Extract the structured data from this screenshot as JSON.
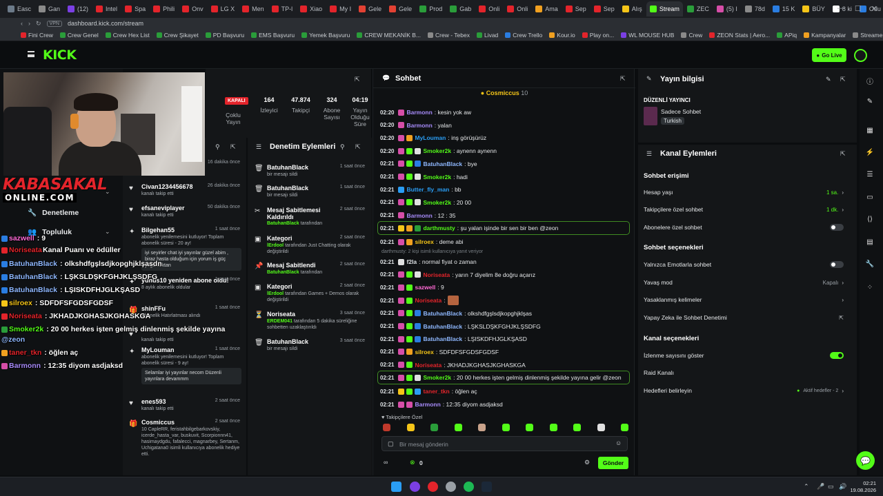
{
  "browser": {
    "tabs": [
      {
        "label": "Easc",
        "color": "#6c7a89"
      },
      {
        "label": "Gan",
        "color": "#8a8a8a"
      },
      {
        "label": "(12)",
        "color": "#7b3fe4"
      },
      {
        "label": "Intel",
        "color": "#e3242b"
      },
      {
        "label": "Spa",
        "color": "#e3242b"
      },
      {
        "label": "Phili",
        "color": "#e3242b"
      },
      {
        "label": "Onv",
        "color": "#e3242b"
      },
      {
        "label": "LG X",
        "color": "#e3242b"
      },
      {
        "label": "Men",
        "color": "#e3242b"
      },
      {
        "label": "TP-l",
        "color": "#e3242b"
      },
      {
        "label": "Xiao",
        "color": "#e3242b"
      },
      {
        "label": "My I",
        "color": "#e3242b"
      },
      {
        "label": "Gele",
        "color": "#e34133"
      },
      {
        "label": "Gele",
        "color": "#e34133"
      },
      {
        "label": "Prod",
        "color": "#2a9d3a"
      },
      {
        "label": "Gab",
        "color": "#2a9d3a"
      },
      {
        "label": "Onli",
        "color": "#e3242b"
      },
      {
        "label": "Onli",
        "color": "#e3242b"
      },
      {
        "label": "Ama",
        "color": "#f0a020"
      },
      {
        "label": "Sep",
        "color": "#e3242b"
      },
      {
        "label": "Sep",
        "color": "#e3242b"
      },
      {
        "label": "Alış",
        "color": "#f5c518"
      },
      {
        "label": "Stream",
        "color": "#53fc18",
        "active": true
      },
      {
        "label": "ZEC",
        "color": "#2a9d3a"
      },
      {
        "label": "(5) I",
        "color": "#d64ea8"
      },
      {
        "label": "78d",
        "color": "#8a8a8a"
      },
      {
        "label": "15 K",
        "color": "#2a7de1"
      },
      {
        "label": "BÜY",
        "color": "#f5c518"
      },
      {
        "label": "8 ki",
        "color": "#ffffff"
      },
      {
        "label": "Odu",
        "color": "#2a7de1"
      },
      {
        "label": "Jak",
        "color": "#e3242b"
      }
    ],
    "url": "dashboard.kick.com/stream",
    "vpn": "VPN",
    "bookmarks": [
      {
        "label": "Fini Crew",
        "color": "#e3242b"
      },
      {
        "label": "Crew Genel",
        "color": "#2a9d3a"
      },
      {
        "label": "Crew Hex List",
        "color": "#2a9d3a"
      },
      {
        "label": "Crew Şikayet",
        "color": "#2a9d3a"
      },
      {
        "label": "PD Başvuru",
        "color": "#2a9d3a"
      },
      {
        "label": "EMS Başvuru",
        "color": "#2a9d3a"
      },
      {
        "label": "Yemek Başvuru",
        "color": "#2a9d3a"
      },
      {
        "label": "CREW MEKANİK B...",
        "color": "#2a9d3a"
      },
      {
        "label": "Crew - Tebex",
        "color": "#8a8a8a"
      },
      {
        "label": "Livad",
        "color": "#2a9d3a"
      },
      {
        "label": "Crew Trello",
        "color": "#2a7de1"
      },
      {
        "label": "Kour.io",
        "color": "#f0a020"
      },
      {
        "label": "Play on...",
        "color": "#e3242b"
      },
      {
        "label": "WL MOUSE HUB",
        "color": "#7b3fe4"
      },
      {
        "label": "Crew",
        "color": "#8a8a8a"
      },
      {
        "label": "ZEON Stats | Aero...",
        "color": "#e3242b"
      },
      {
        "label": "APiq",
        "color": "#2a9d3a"
      },
      {
        "label": "Kampanyalar",
        "color": "#f0a020"
      },
      {
        "label": "Streamer Panel",
        "color": "#8a8a8a"
      }
    ]
  },
  "header": {
    "logo": "KICK",
    "go_live": "Go Live"
  },
  "overlay": {
    "brand_big": "KABASAKAL",
    "brand_small": "ONLINE.COM",
    "chat": [
      {
        "user": "sazwell",
        "text": ": 9",
        "color": "#ff6ad5",
        "badge": "#2a7de1"
      },
      {
        "user": "Noriseata",
        "text": "",
        "color": "#e3242b",
        "badge": "#e3242b"
      },
      {
        "user": "BatuhanBlack",
        "text": ": olkshdfgşlsdjkopghjklşasdn",
        "color": "#8fb8ff",
        "badge": "#2a7de1"
      },
      {
        "user": "BatuhanBlack",
        "text": ": LŞKSLDŞKFGHJKLŞSDFG",
        "color": "#8fb8ff",
        "badge": "#2a7de1"
      },
      {
        "user": "BatuhanBlack",
        "text": ": LŞISKDFHJGLKŞASD",
        "color": "#8fb8ff",
        "badge": "#2a7de1"
      },
      {
        "user": "silroex",
        "text": ": SDFDFSFGDSFGDSF",
        "color": "#f5c518",
        "badge": "#f5c518"
      },
      {
        "user": "Noriseata",
        "text": ": JKHADJKGHASJKGHASKGA",
        "color": "#e3242b",
        "badge": "#e3242b"
      },
      {
        "user": "Smoker2k",
        "text": ": 20 00 herkes işten gelmiş dinlenmiş şekilde yayına",
        "color": "#53fc18",
        "badge": "#2a9d3a"
      },
      {
        "user": "@zeon",
        "text": "",
        "color": "#8fb8ff",
        "badge": ""
      },
      {
        "user": "taner_tkn",
        "text": ": öğlen aç",
        "color": "#e3242b",
        "badge": "#f0a020"
      },
      {
        "user": "Barmonn",
        "text": ": 12:35 diyom asdjaksd",
        "color": "#a78bfa",
        "badge": "#d64ea8"
      }
    ]
  },
  "leftnav": {
    "items": [
      {
        "label": "Denetleme"
      },
      {
        "label": "Topluluk"
      },
      {
        "label": "Kanal Puanı ve ödüller"
      }
    ]
  },
  "stats": {
    "status": "KAPALI",
    "chat_mode_label": "Çoklu Yayın",
    "viewers": {
      "value": "164",
      "label": "İzleyici"
    },
    "followers": {
      "value": "47.874",
      "label": "Takipçi"
    },
    "subs": {
      "value": "324",
      "label": "Abone Sayısı"
    },
    "duration": {
      "value": "04:19",
      "label": "Yayın Olduğu Süre"
    }
  },
  "activity": [
    {
      "name": "",
      "time": "16 dakika önce",
      "sub": "kanalı takip etti",
      "icon": "heart-icon"
    },
    {
      "name": "Civan1234456678",
      "time": "26 dakika önce",
      "sub": "kanalı takip etti",
      "icon": "heart-icon"
    },
    {
      "name": "efsaneviplayer",
      "time": "50 dakika önce",
      "sub": "kanalı takip etti",
      "icon": "heart-icon"
    },
    {
      "name": "Bilgehan55",
      "time": "1 saat önce",
      "sub": "abonelik yenilemesini kutluyor! Toplam abonelik süresi - 20 ay!",
      "box": "iyi seyirler chat iyi yayınlar güzel abim , biraz hasta olduğum için yorum iş güç yoğunluktan",
      "icon": "star-icon"
    },
    {
      "name": "yunus10 yeniden abone oldu!",
      "time": "1 saat önce",
      "sub": "8 aylık abonelik oldular",
      "icon": "star-icon"
    },
    {
      "name": "shinFFu",
      "time": "1 saat önce",
      "sub": "Abonelik Hatırlatması alındı",
      "icon": "gift-icon"
    },
    {
      "name": "",
      "time": "",
      "sub": "kanalı takip etti",
      "icon": "heart-icon"
    },
    {
      "name": "MyLouman",
      "time": "1 saat önce",
      "sub": "abonelik yenilemesini kutluyor! Toplam abonelik süresi - 9 ay!",
      "box": "Selamlar iyi yayınlar necom Düzenli yayınlara devammm",
      "icon": "star-icon"
    },
    {
      "name": "enes593",
      "time": "2 saat önce",
      "sub": "kanalı takip etti",
      "icon": "heart-icon"
    },
    {
      "name": "Cosmiccus",
      "time": "2 saat önce",
      "sub": "10 CapleRR, feristahbilgebarkovskiy, icerde_hasta_var, buskuvit, Scorpionnn41, hasimaydgdu, fafalecci, magnarbey, Sertanm, Uchigatana0 isimli kullanıcıya abonelik hediye etti.",
      "icon": "gift-icon"
    }
  ],
  "moderation": {
    "title": "Denetim Eylemleri",
    "items": [
      {
        "name": "BatuhanBlack",
        "time": "1 saat önce",
        "sub": "bir mesajı sildi",
        "icon": "trash-icon"
      },
      {
        "name": "BatuhanBlack",
        "time": "1 saat önce",
        "sub": "bir mesajı sildi",
        "icon": "trash-icon"
      },
      {
        "name": "Mesaj Sabitlemesi Kaldırıldı",
        "time": "2 saat önce",
        "sub_user": "BatuhanBlack",
        "sub": "tarafından",
        "icon": "unpin-icon"
      },
      {
        "name": "Kategori",
        "time": "2 saat önce",
        "sub_user": "lErdool",
        "sub": "tarafından Just Chatting olarak değiştirildi",
        "icon": "category-icon"
      },
      {
        "name": "Mesaj Sabitlendi",
        "time": "2 saat önce",
        "sub_user": "BatuhanBlack",
        "sub": "tarafından",
        "icon": "pin-icon"
      },
      {
        "name": "Kategori",
        "time": "2 saat önce",
        "sub_user": "lErdool",
        "sub": "tarafından Games + Demos olarak değiştirildi",
        "icon": "category-icon"
      },
      {
        "name": "Noriseata",
        "time": "3 saat önce",
        "sub_user": "ERDEM041",
        "sub": "tarafından 5 dakika süreliğine sohbetten uzaklaştırıldı",
        "icon": "timeout-icon"
      },
      {
        "name": "BatuhanBlack",
        "time": "3 saat önce",
        "sub": "bir mesajı sildi",
        "icon": "trash-icon"
      }
    ]
  },
  "chat": {
    "title": "Sohbet",
    "pinned_user": "Cosmiccus",
    "pinned_count": "10",
    "messages": [
      {
        "time": "02:20",
        "user": "Barmonn",
        "text": ": kesin yok aw",
        "color": "#a78bfa",
        "badges": [
          "#d64ea8"
        ]
      },
      {
        "time": "02:20",
        "user": "Barmonn",
        "text": ": yalan",
        "color": "#a78bfa",
        "badges": [
          "#d64ea8"
        ]
      },
      {
        "time": "02:20",
        "user": "MyLouman",
        "text": ": inş görüşürüz",
        "color": "#2a9df4",
        "badges": [
          "#d64ea8",
          "#f0a020"
        ]
      },
      {
        "time": "02:20",
        "user": "Smoker2k",
        "text": ": aynenn aynenn",
        "color": "#53fc18",
        "badges": [
          "#d64ea8",
          "#53fc18",
          "#e0e0e0"
        ]
      },
      {
        "time": "02:21",
        "user": "BatuhanBlack",
        "text": ": bye",
        "color": "#8fb8ff",
        "badges": [
          "#d64ea8",
          "#53fc18",
          "#2a7de1"
        ]
      },
      {
        "time": "02:21",
        "user": "Smoker2k",
        "text": ": hadi",
        "color": "#53fc18",
        "badges": [
          "#d64ea8",
          "#53fc18",
          "#e0e0e0"
        ]
      },
      {
        "time": "02:21",
        "user": "Butter_fly_man",
        "text": ": bb",
        "color": "#2a9df4",
        "badges": [
          "#2a9df4"
        ]
      },
      {
        "time": "02:21",
        "user": "Smoker2k",
        "text": ": 20 00",
        "color": "#53fc18",
        "badges": [
          "#d64ea8",
          "#53fc18",
          "#e0e0e0"
        ]
      },
      {
        "time": "02:21",
        "user": "Barmonn",
        "text": ": 12 : 35",
        "color": "#a78bfa",
        "badges": [
          "#d64ea8"
        ]
      },
      {
        "time": "02:21",
        "user": "darthmusty",
        "text": ": şu yalan işinde bir sen bir ben @zeon",
        "color": "#53fc18",
        "badges": [
          "#f5c518",
          "#f0a020",
          "#2a9d3a"
        ],
        "highlight": true
      },
      {
        "time": "02:21",
        "user": "silroex",
        "text": ": deme abi",
        "color": "#f5c518",
        "badges": [
          "#d64ea8",
          "#f0a020"
        ]
      },
      {
        "time": "02:21",
        "user": "f2la",
        "text": ": normal fiyat o zaman",
        "color": "#dfe3e6",
        "badges": [
          "#e0e0e0"
        ]
      },
      {
        "time": "02:21",
        "user": "Noriseata",
        "text": ": yarın 7 diyelim 8e doğru açarız",
        "color": "#e3242b",
        "badges": [
          "#d64ea8",
          "#53fc18",
          "#e0e0e0"
        ]
      },
      {
        "time": "02:21",
        "user": "sazwell",
        "text": ": 9",
        "color": "#ff6ad5",
        "badges": [
          "#d64ea8",
          "#53fc18"
        ]
      },
      {
        "time": "02:21",
        "user": "Noriseata",
        "text": ":",
        "color": "#e3242b",
        "badges": [
          "#d64ea8",
          "#53fc18"
        ]
      },
      {
        "time": "02:21",
        "user": "BatuhanBlack",
        "text": ": olkshdfgşlsdjkopghjklşas",
        "color": "#8fb8ff",
        "badges": [
          "#d64ea8",
          "#53fc18",
          "#2a7de1"
        ]
      },
      {
        "time": "02:21",
        "user": "BatuhanBlack",
        "text": ": LŞKSLDŞKFGHJKLŞSDFG",
        "color": "#8fb8ff",
        "badges": [
          "#d64ea8",
          "#53fc18",
          "#2a7de1"
        ]
      },
      {
        "time": "02:21",
        "user": "BatuhanBlack",
        "text": ": LŞISKDFHJGLKŞASD",
        "color": "#8fb8ff",
        "badges": [
          "#d64ea8",
          "#53fc18",
          "#2a7de1"
        ]
      },
      {
        "time": "02:21",
        "user": "silroex",
        "text": ": SDFDFSFGDSFGDSF",
        "color": "#f5c518",
        "badges": [
          "#d64ea8",
          "#f0a020"
        ]
      },
      {
        "time": "02:21",
        "user": "Noriseata",
        "text": ": JKHADJKGHASJKGHASKGA",
        "color": "#e3242b",
        "badges": [
          "#d64ea8",
          "#53fc18"
        ]
      },
      {
        "time": "02:21",
        "user": "Smoker2k",
        "text": ": 20 00 herkes işten gelmiş dinlenmiş şekilde yayına gelir @zeon",
        "color": "#53fc18",
        "badges": [
          "#d64ea8",
          "#53fc18",
          "#e0e0e0"
        ],
        "highlight": true
      },
      {
        "time": "02:21",
        "user": "taner_tkn",
        "text": ": öğlen aç",
        "color": "#e3242b",
        "badges": [
          "#f5c518",
          "#53fc18",
          "#2a9df4"
        ]
      },
      {
        "time": "02:21",
        "user": "Barmonn",
        "text": ": 12:35 diyom asdjaksd",
        "color": "#a78bfa",
        "badges": [
          "#d64ea8",
          "#d64ea8"
        ]
      }
    ],
    "reply_hint": "darthmusty: 2 kişi isimli kullanıcıya yanıt veriyor",
    "followers_only": "Takipçilere Özel",
    "input_placeholder": "Bir mesaj gönderin",
    "send_label": "Gönder",
    "timer_label": "0"
  },
  "stream_info": {
    "title": "Yayın bilgisi",
    "regular_label": "DÜZENLİ YAYINCI",
    "category": "Sadece Sohbet",
    "language": "Turkish"
  },
  "channel_actions": {
    "title": "Kanal Eylemleri",
    "chat_access_title": "Sohbet erişimi",
    "account_age": {
      "label": "Hesap yaşı",
      "value": "1 sa."
    },
    "followers_chat": {
      "label": "Takipçilere özel sohbet",
      "value": "1 dk."
    },
    "subs_chat": {
      "label": "Abonelere özel sohbet"
    },
    "chat_options_title": "Sohbet seçenekleri",
    "emotes_only": {
      "label": "Yalnızca Emotlarla sohbet"
    },
    "slow_mode": {
      "label": "Yavaş mod",
      "value": "Kapalı"
    },
    "banned_words": {
      "label": "Yasaklanmış kelimeler"
    },
    "ai_moderation": {
      "label": "Yapay Zeka ile Sohbet Denetimi"
    },
    "channel_options_title": "Kanal seçenekleri",
    "show_viewers": {
      "label": "İzlenme sayısını göster"
    },
    "raid": {
      "label": "Raid Kanalı"
    },
    "goals": {
      "label": "Hedefleri belirleyin",
      "value": "Aktif hedefler - 2"
    }
  },
  "taskbar": {
    "time": "02:21",
    "date": "19.08.2026"
  }
}
